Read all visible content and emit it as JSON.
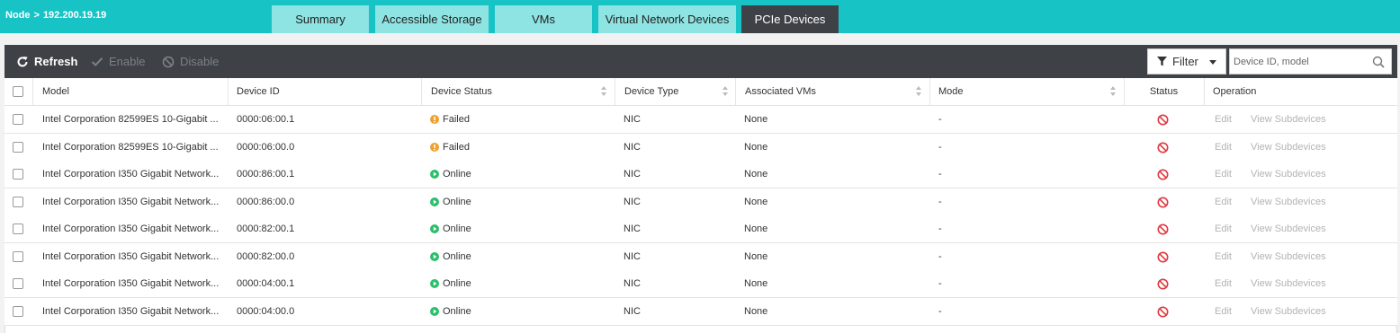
{
  "breadcrumb": {
    "root": "Node",
    "separator": ">",
    "current": "192.200.19.19"
  },
  "tabs": [
    {
      "label": "Summary",
      "active": false
    },
    {
      "label": "Accessible Storage",
      "active": false
    },
    {
      "label": "VMs",
      "active": false
    },
    {
      "label": "Virtual Network Devices",
      "active": false
    },
    {
      "label": "PCIe Devices",
      "active": true
    }
  ],
  "toolbar": {
    "refresh_label": "Refresh",
    "enable_label": "Enable",
    "disable_label": "Disable",
    "filter_label": "Filter",
    "search_placeholder": "Device ID, model"
  },
  "table": {
    "columns": {
      "model": "Model",
      "device_id": "Device ID",
      "device_status": "Device Status",
      "device_type": "Device Type",
      "associated_vms": "Associated VMs",
      "mode": "Mode",
      "status": "Status",
      "operation": "Operation"
    },
    "rows": [
      {
        "model": "Intel Corporation 82599ES 10-Gigabit ...",
        "device_id": "0000:06:00.1",
        "device_status": "Failed",
        "device_type": "NIC",
        "associated_vms": "None",
        "mode": "-",
        "edit": "Edit",
        "view_subdevices": "View Subdevices"
      },
      {
        "model": "Intel Corporation 82599ES 10-Gigabit ...",
        "device_id": "0000:06:00.0",
        "device_status": "Failed",
        "device_type": "NIC",
        "associated_vms": "None",
        "mode": "-",
        "edit": "Edit",
        "view_subdevices": "View Subdevices"
      },
      {
        "model": "Intel Corporation I350 Gigabit Network...",
        "device_id": "0000:86:00.1",
        "device_status": "Online",
        "device_type": "NIC",
        "associated_vms": "None",
        "mode": "-",
        "edit": "Edit",
        "view_subdevices": "View Subdevices"
      },
      {
        "model": "Intel Corporation I350 Gigabit Network...",
        "device_id": "0000:86:00.0",
        "device_status": "Online",
        "device_type": "NIC",
        "associated_vms": "None",
        "mode": "-",
        "edit": "Edit",
        "view_subdevices": "View Subdevices"
      },
      {
        "model": "Intel Corporation I350 Gigabit Network...",
        "device_id": "0000:82:00.1",
        "device_status": "Online",
        "device_type": "NIC",
        "associated_vms": "None",
        "mode": "-",
        "edit": "Edit",
        "view_subdevices": "View Subdevices"
      },
      {
        "model": "Intel Corporation I350 Gigabit Network...",
        "device_id": "0000:82:00.0",
        "device_status": "Online",
        "device_type": "NIC",
        "associated_vms": "None",
        "mode": "-",
        "edit": "Edit",
        "view_subdevices": "View Subdevices"
      },
      {
        "model": "Intel Corporation I350 Gigabit Network...",
        "device_id": "0000:04:00.1",
        "device_status": "Online",
        "device_type": "NIC",
        "associated_vms": "None",
        "mode": "-",
        "edit": "Edit",
        "view_subdevices": "View Subdevices"
      },
      {
        "model": "Intel Corporation I350 Gigabit Network...",
        "device_id": "0000:04:00.0",
        "device_status": "Online",
        "device_type": "NIC",
        "associated_vms": "None",
        "mode": "-",
        "edit": "Edit",
        "view_subdevices": "View Subdevices"
      }
    ]
  },
  "colors": {
    "header_teal": "#18c3c6",
    "tab_inactive": "#8ee3e3",
    "tab_active": "#3e4247",
    "failed": "#f0a030",
    "online": "#2bbf6a",
    "disabled_status": "#e0383e"
  },
  "icons": {
    "refresh": "refresh-icon",
    "enable": "check-icon",
    "disable": "ban-icon",
    "filter": "funnel-icon",
    "search": "search-icon",
    "failed": "exclamation-icon",
    "online": "play-icon",
    "status": "prohibited-icon"
  }
}
